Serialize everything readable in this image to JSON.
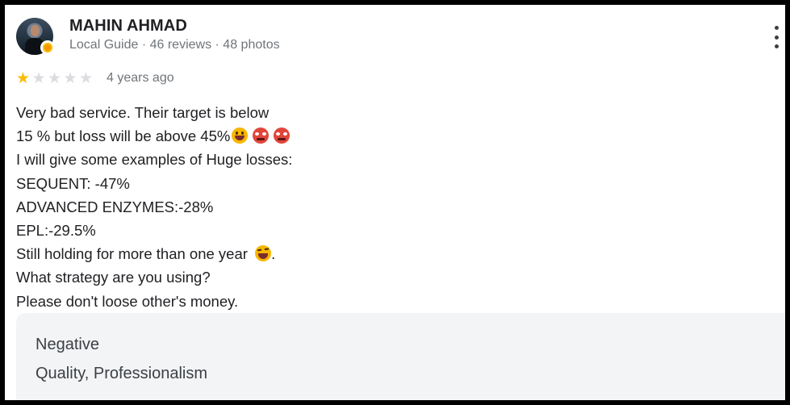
{
  "reviewer": {
    "name": "MAHIN AHMAD",
    "meta": "Local Guide · 46 reviews · 48 photos",
    "avatar_icon": "user-photo",
    "badge_icon": "local-guide-badge"
  },
  "rating": {
    "stars": 1,
    "max_stars": 5,
    "time": "4 years ago",
    "star_color": "#fbbc04"
  },
  "review": {
    "lines": [
      "Very bad service. Their target is below",
      "15 % but loss will be above 45%",
      "I will give some examples of Huge losses:",
      "SEQUENT: -47%",
      "ADVANCED ENZYMES:-28%",
      "EPL:-29.5%",
      "Still holding for more than one year",
      "What strategy are you using?",
      "Please don't loose other's money."
    ],
    "line7_suffix": "."
  },
  "attributes": {
    "sentiment": "Negative",
    "topics": "Quality, Professionalism"
  },
  "menu": {
    "icon": "more-vert-icon"
  }
}
